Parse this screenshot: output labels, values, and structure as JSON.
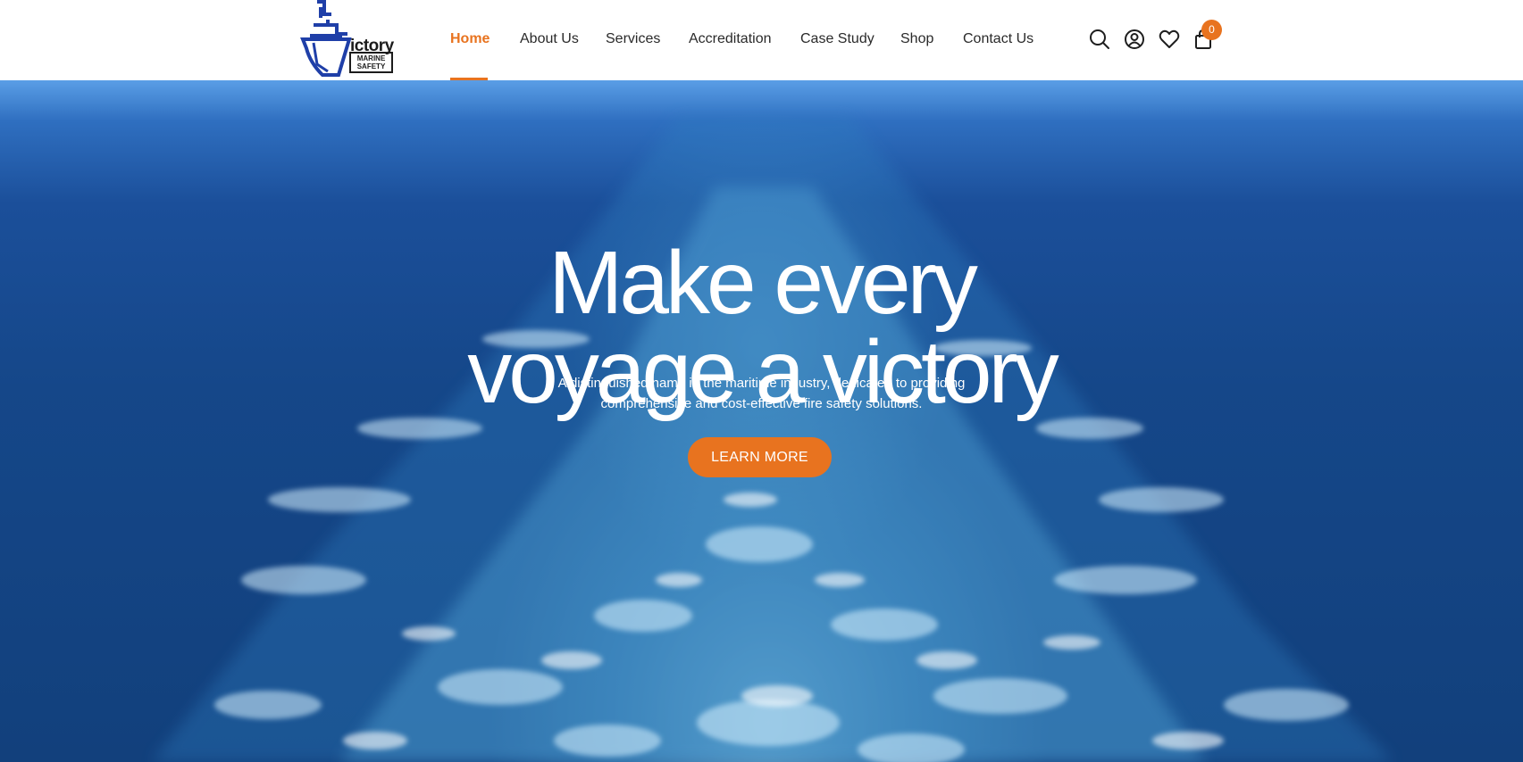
{
  "brand": {
    "logo_name": "ship-logo",
    "logo_text": "ictory",
    "logo_sub_line1": "MARINE",
    "logo_sub_line2": "SAFETY",
    "logo_color": "#1f3fa8"
  },
  "nav": {
    "items": [
      {
        "label": "Home",
        "active": true
      },
      {
        "label": "About Us",
        "active": false
      },
      {
        "label": "Services",
        "active": false
      },
      {
        "label": "Accreditation",
        "active": false
      },
      {
        "label": "Case Study",
        "active": false
      },
      {
        "label": "Shop",
        "active": false
      },
      {
        "label": "Contact Us",
        "active": false
      }
    ],
    "active_color": "#e8731f"
  },
  "header_icons": {
    "search": "search-icon",
    "account": "user-circle-icon",
    "wishlist": "heart-icon",
    "cart": "shopping-bag-icon",
    "cart_count": "0"
  },
  "hero": {
    "title_line1": "Make every",
    "title_line2": "voyage a victory",
    "subtitle_line1": "A distinguished name in the maritime industry, dedicated to providing",
    "subtitle_line2": "comprehensive and cost-effective fire safety solutions.",
    "cta_label": "LEARN MORE",
    "background": "ocean-wake-photo"
  },
  "colors": {
    "accent": "#e8731f",
    "text_dark": "#2a2a2a",
    "ocean": "#154789"
  }
}
